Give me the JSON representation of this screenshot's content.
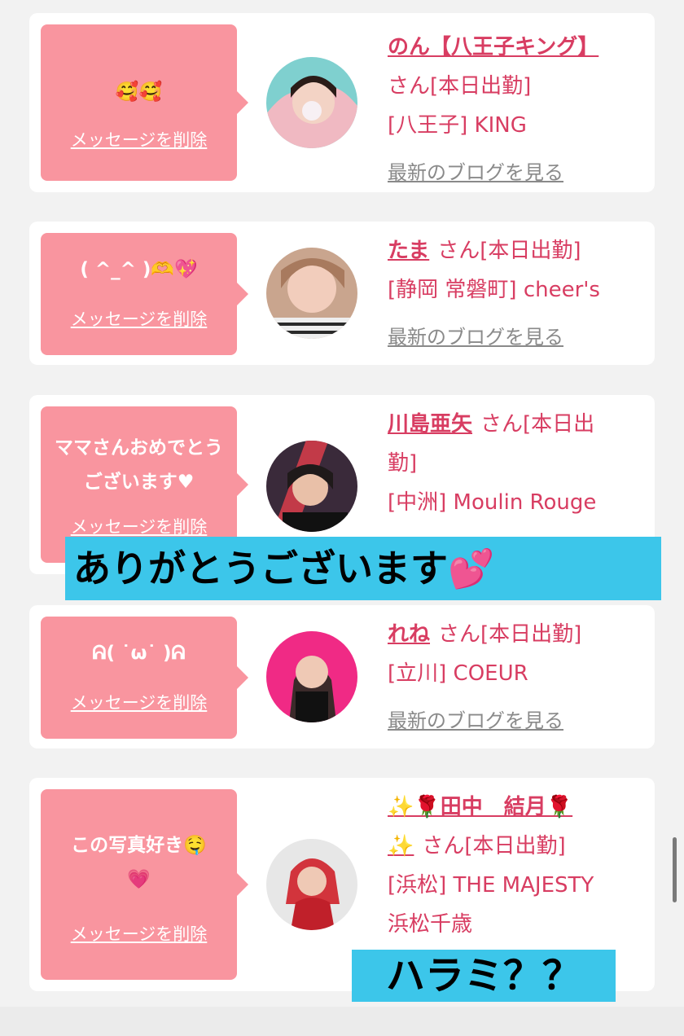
{
  "delete_label": "メッセージを削除",
  "blog_label": "最新のブログを見る",
  "cards": [
    {
      "message": "🥰🥰",
      "name_line1": "のん【八王子キング】",
      "san": "さん[本日出勤]",
      "shop": "[八王子] KING"
    },
    {
      "message": "( ^_^ )🫶💖",
      "name": "たま",
      "san": "さん[本日出勤]",
      "shop": "[静岡 常磐町] cheer's"
    },
    {
      "message": "ママさんおめでとうございます♥",
      "name": "川島亜矢",
      "san_a": "さん[本日出",
      "san_b": "勤]",
      "shop": "[中洲] Moulin Rouge"
    },
    {
      "message": "ᕱ( ˙ω˙ )ᕱ",
      "name": "れね",
      "san": "さん[本日出勤]",
      "shop": "[立川] COEUR"
    },
    {
      "message_a": "この写真好き🤤",
      "message_b": "💗",
      "name_line1": "✨🌹田中　結月🌹",
      "name_line2": "✨",
      "san": "さん[本日出勤]",
      "shop_a": "[浜松] THE MAJESTY",
      "shop_b": "浜松千歳"
    }
  ],
  "overlays": {
    "thanks": "ありがとうございます",
    "thanks_heart": "💕",
    "harami": "ハラミ？？"
  },
  "colors": {
    "accent": "#d83d62",
    "bubble": "#f9959f",
    "highlight": "#3cc6ea"
  }
}
